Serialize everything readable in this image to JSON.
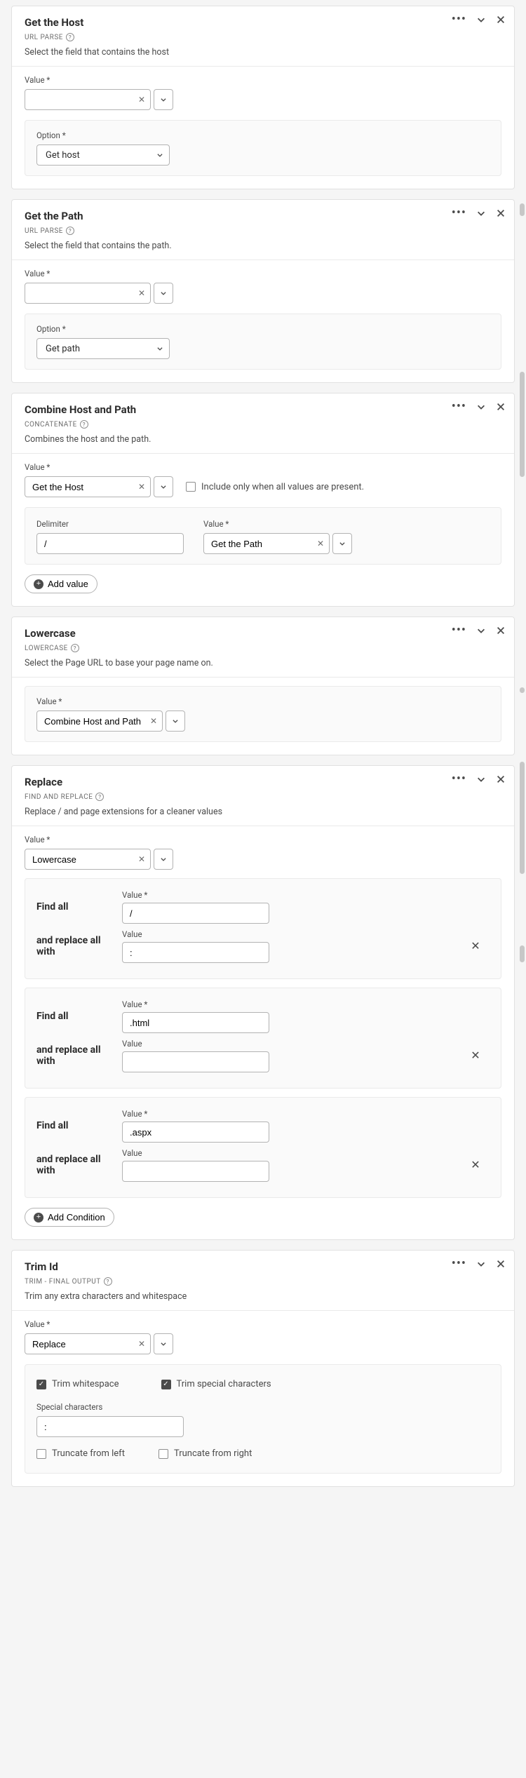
{
  "labels": {
    "value": "Value",
    "option": "Option",
    "delimiter": "Delimiter",
    "findAll": "Find all",
    "replaceAllWith": "and replace all with",
    "addValue": "Add value",
    "addCondition": "Add Condition",
    "specialChars": "Special characters"
  },
  "cards": {
    "getHost": {
      "title": "Get the Host",
      "subtitle": "URL PARSE",
      "desc": "Select the field that contains the host",
      "value": "",
      "option": "Get host"
    },
    "getPath": {
      "title": "Get the Path",
      "subtitle": "URL PARSE",
      "desc": "Select the field that contains the path.",
      "value": "",
      "option": "Get path"
    },
    "combine": {
      "title": "Combine Host and Path",
      "subtitle": "CONCATENATE",
      "desc": "Combines the host and the path.",
      "value": "Get the Host",
      "includeLabel": "Include only when all values are present.",
      "delimiter": "/",
      "value2": "Get the Path"
    },
    "lowercase": {
      "title": "Lowercase",
      "subtitle": "LOWERCASE",
      "desc": "Select the Page URL to base your page name on.",
      "value": "Combine Host and Path"
    },
    "replace": {
      "title": "Replace",
      "subtitle": "FIND AND REPLACE",
      "desc": "Replace / and page extensions for a cleaner values",
      "value": "Lowercase",
      "rows": [
        {
          "find": "/",
          "replace": ":"
        },
        {
          "find": ".html",
          "replace": ""
        },
        {
          "find": ".aspx",
          "replace": ""
        }
      ]
    },
    "trim": {
      "title": "Trim Id",
      "subtitle": "TRIM - FINAL OUTPUT",
      "desc": "Trim any extra characters and whitespace",
      "value": "Replace",
      "trimWhitespaceLabel": "Trim whitespace",
      "trimSpecialLabel": "Trim special characters",
      "truncLeftLabel": "Truncate from left",
      "truncRightLabel": "Truncate from right",
      "specialCharsValue": ":"
    }
  }
}
